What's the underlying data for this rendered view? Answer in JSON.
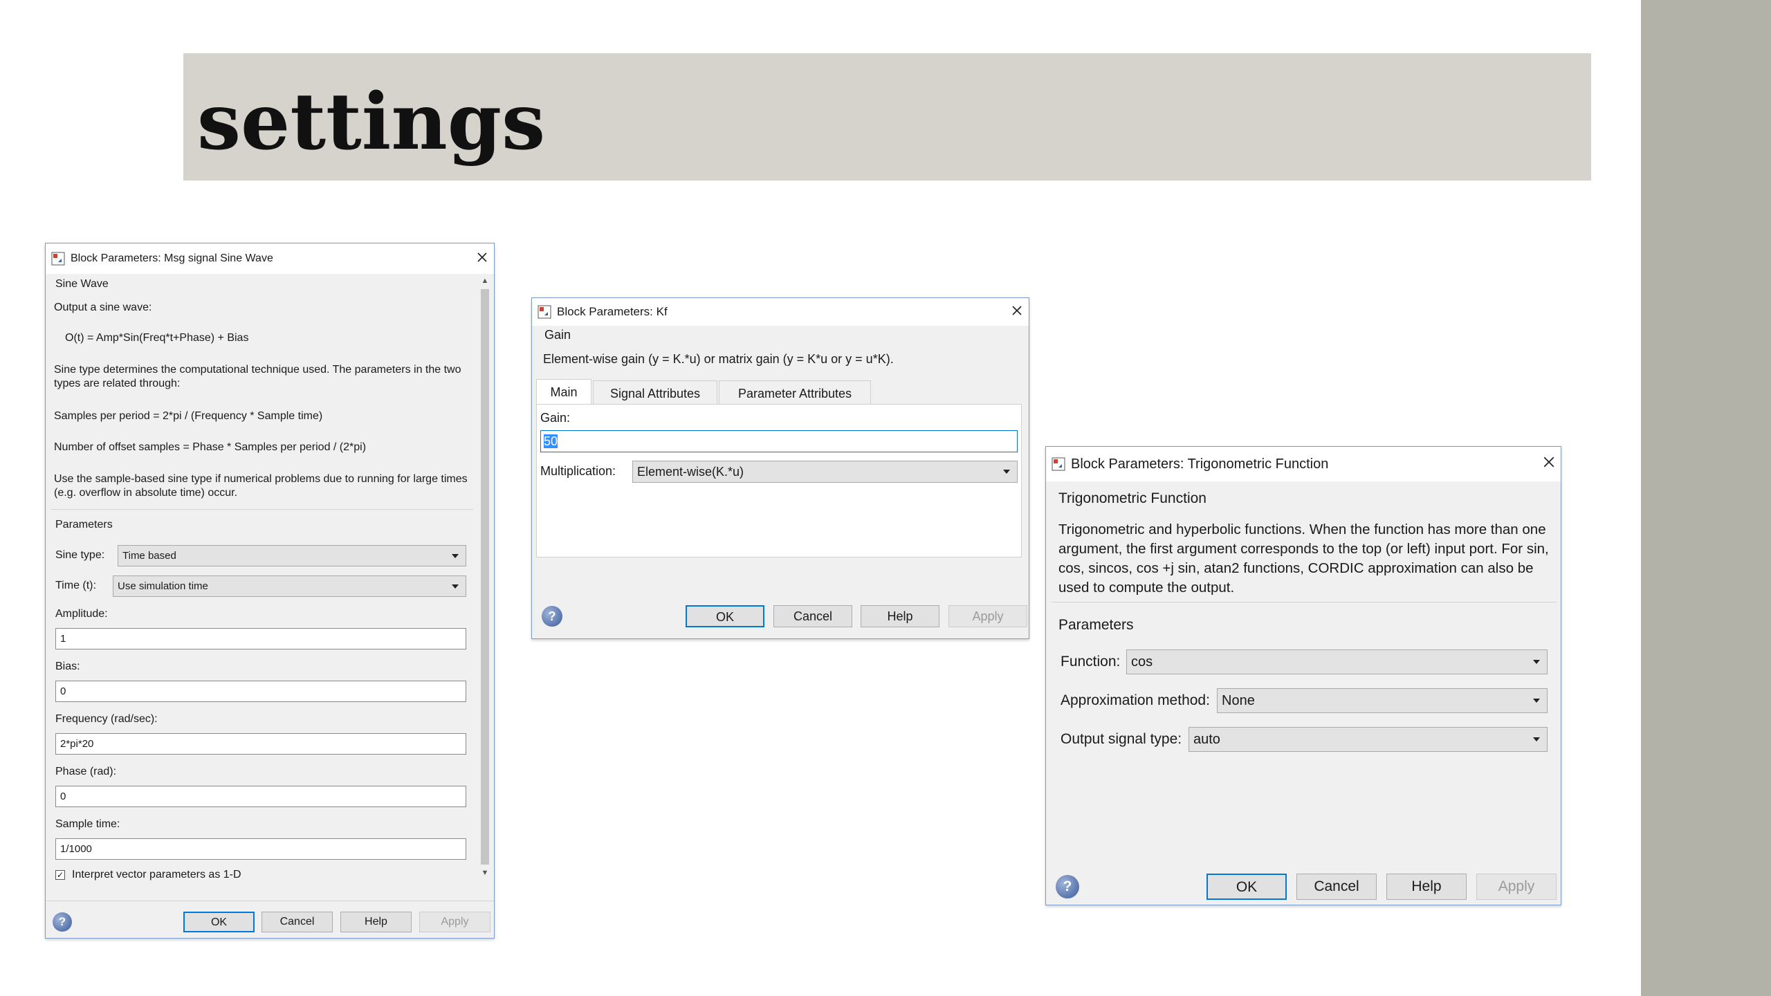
{
  "slide": {
    "title": "settings"
  },
  "sine_dialog": {
    "title": "Block Parameters: Msg signal Sine Wave",
    "section": "Sine Wave",
    "description": {
      "line1": "Output a sine wave:",
      "equation": "O(t) = Amp*Sin(Freq*t+Phase) + Bias",
      "para1": "Sine type determines the computational technique used. The parameters in the two types are related through:",
      "samples_per_period": "Samples per period = 2*pi / (Frequency * Sample time)",
      "offset_samples": "Number of offset samples = Phase * Samples per period / (2*pi)",
      "para2": "Use the sample-based sine type if numerical problems due to running for large times (e.g. overflow in absolute time) occur."
    },
    "parameters_label": "Parameters",
    "sine_type_label": "Sine type:",
    "sine_type_value": "Time based",
    "time_label": "Time (t):",
    "time_value": "Use simulation time",
    "amplitude_label": "Amplitude:",
    "amplitude_value": "1",
    "bias_label": "Bias:",
    "bias_value": "0",
    "frequency_label": "Frequency (rad/sec):",
    "frequency_value": "2*pi*20",
    "phase_label": "Phase (rad):",
    "phase_value": "0",
    "sample_time_label": "Sample time:",
    "sample_time_value": "1/1000",
    "interpret_vector_label": "Interpret vector parameters as 1-D",
    "interpret_vector_checked": true,
    "buttons": {
      "ok": "OK",
      "cancel": "Cancel",
      "help": "Help",
      "apply": "Apply"
    }
  },
  "gain_dialog": {
    "title": "Block Parameters: Kf",
    "section": "Gain",
    "description": "Element-wise gain (y = K.*u) or matrix gain (y = K*u or y = u*K).",
    "tabs": [
      "Main",
      "Signal Attributes",
      "Parameter Attributes"
    ],
    "active_tab": "Main",
    "gain_label": "Gain:",
    "gain_value": "50",
    "multiplication_label": "Multiplication:",
    "multiplication_value": "Element-wise(K.*u)",
    "buttons": {
      "ok": "OK",
      "cancel": "Cancel",
      "help": "Help",
      "apply": "Apply"
    }
  },
  "trig_dialog": {
    "title": "Block Parameters: Trigonometric Function",
    "section": "Trigonometric Function",
    "description": "Trigonometric and hyperbolic functions. When the function has more than one argument, the first argument corresponds to the top (or left) input port. For sin, cos, sincos, cos +j sin, atan2 functions, CORDIC approximation can also be used to compute the output.",
    "parameters_label": "Parameters",
    "function_label": "Function:",
    "function_value": "cos",
    "approx_label": "Approximation method:",
    "approx_value": "None",
    "output_type_label": "Output signal type:",
    "output_type_value": "auto",
    "buttons": {
      "ok": "OK",
      "cancel": "Cancel",
      "help": "Help",
      "apply": "Apply"
    }
  },
  "icons": {
    "app": "block-parameters-icon",
    "close": "close-icon",
    "help": "help-icon",
    "dropdown": "chevron-down-icon"
  },
  "colors": {
    "title_band": "#d5d3cc",
    "side_bar": "#b3b2a8",
    "default_button_border": "#0078d7",
    "selection": "#3390ff"
  }
}
